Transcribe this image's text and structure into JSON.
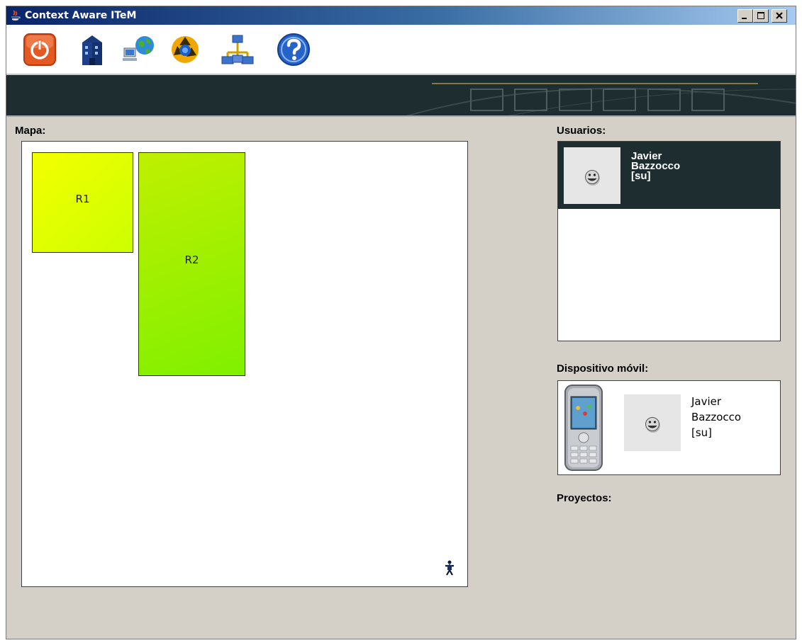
{
  "window": {
    "title": "Context Aware ITeM",
    "controls": [
      "minimize-icon",
      "maximize-icon",
      "close-icon"
    ]
  },
  "toolbar": {
    "buttons": [
      {
        "icon": "power-icon",
        "color": "#e8501f"
      },
      {
        "icon": "building-icon",
        "color": "#1d3f8a"
      },
      {
        "icon": "network-globe-icon",
        "color": "#2e8bd8"
      },
      {
        "icon": "sync-cycle-icon",
        "color": "#f0a800"
      },
      {
        "icon": "network-nodes-icon",
        "color": "#3a73c9"
      },
      {
        "icon": "help-icon",
        "color": "#2563c9"
      }
    ]
  },
  "map": {
    "label": "Mapa:",
    "rooms": [
      {
        "name": "R1",
        "color": "#e6ff00"
      },
      {
        "name": "R2",
        "color": "#9cf200"
      }
    ],
    "person_icon": "person-icon"
  },
  "users": {
    "label": "Usuarios:",
    "items": [
      {
        "first": "Javier",
        "last": "Bazzocco",
        "role": "[su]",
        "avatar": "smiley-icon"
      }
    ]
  },
  "device": {
    "label": "Dispositivo móvil:",
    "phone_icon": "mobile-phone-icon",
    "user": {
      "first": "Javier",
      "last": "Bazzocco",
      "role": "[su]",
      "avatar": "smiley-icon"
    }
  },
  "projects": {
    "label": "Proyectos:"
  },
  "colors": {
    "title_gradient_start": "#0a246a",
    "banner": "#1e2d2f",
    "window_bg": "#d4d0c8"
  }
}
